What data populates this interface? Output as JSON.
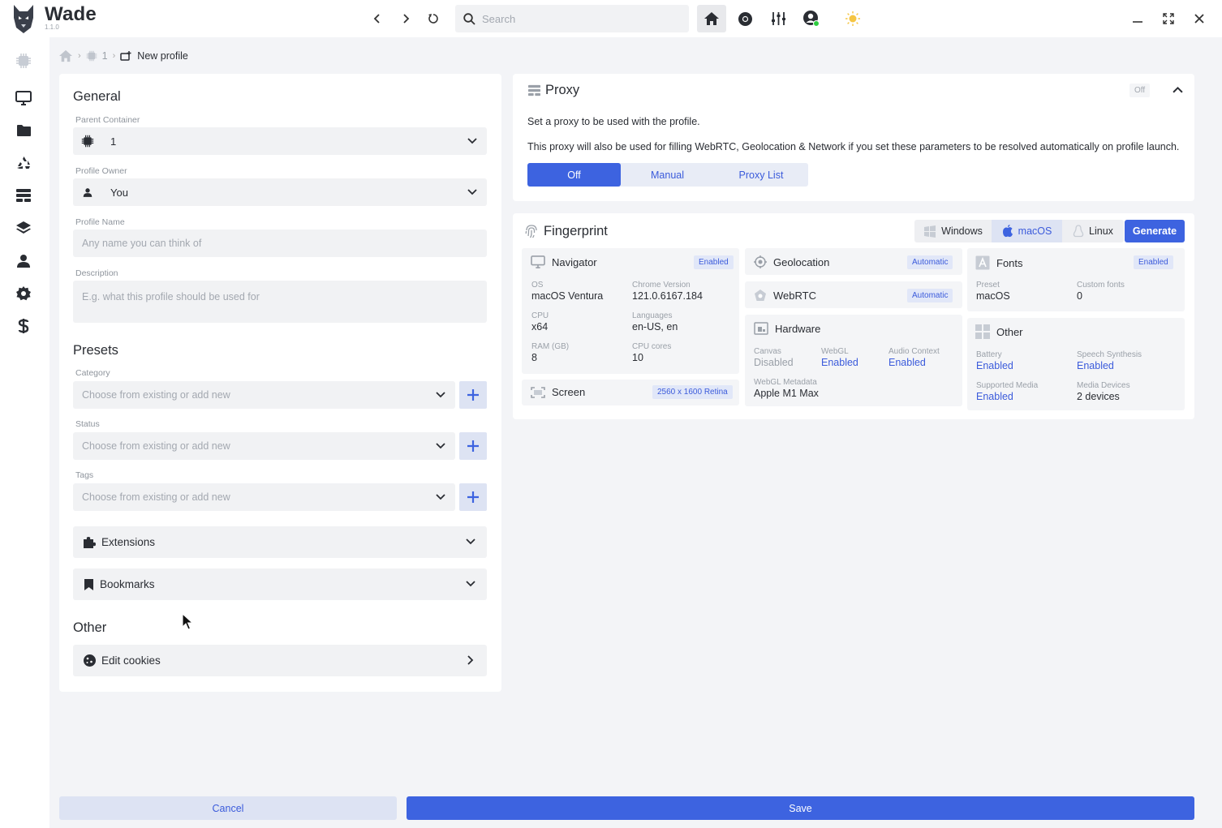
{
  "app": {
    "name": "Wade",
    "version": "1.1.0"
  },
  "titlebar": {
    "search_placeholder": "Search"
  },
  "breadcrumb": {
    "container": "1",
    "current": "New profile"
  },
  "general": {
    "title": "General",
    "parent_container": {
      "label": "Parent Container",
      "value": "1"
    },
    "profile_owner": {
      "label": "Profile Owner",
      "value": "You"
    },
    "profile_name": {
      "label": "Profile Name",
      "placeholder": "Any name you can think of"
    },
    "description": {
      "label": "Description",
      "placeholder": "E.g. what this profile should be used for"
    }
  },
  "presets": {
    "title": "Presets",
    "category": {
      "label": "Category",
      "placeholder": "Choose from existing or add new"
    },
    "status": {
      "label": "Status",
      "placeholder": "Choose from existing or add new"
    },
    "tags": {
      "label": "Tags",
      "placeholder": "Choose from existing or add new"
    },
    "extensions": "Extensions",
    "bookmarks": "Bookmarks"
  },
  "other": {
    "title": "Other",
    "edit_cookies": "Edit cookies"
  },
  "proxy": {
    "title": "Proxy",
    "status": "Off",
    "desc1": "Set a proxy to be used with the profile.",
    "desc2": "This proxy will also be used for filling WebRTC, Geolocation & Network if you set these parameters to be resolved automatically on profile launch.",
    "tabs": [
      "Off",
      "Manual",
      "Proxy List"
    ],
    "active_tab": "Off"
  },
  "fingerprint": {
    "title": "Fingerprint",
    "os_tabs": [
      "Windows",
      "macOS",
      "Linux"
    ],
    "selected_os": "macOS",
    "generate": "Generate",
    "navigator": {
      "title": "Navigator",
      "badge": "Enabled",
      "os_label": "OS",
      "os": "macOS Ventura",
      "chrome_label": "Chrome Version",
      "chrome": "121.0.6167.184",
      "cpu_label": "CPU",
      "cpu": "x64",
      "lang_label": "Languages",
      "lang": "en-US, en",
      "ram_label": "RAM (GB)",
      "ram": "8",
      "cores_label": "CPU cores",
      "cores": "10"
    },
    "screen": {
      "title": "Screen",
      "badge": "2560 x 1600 Retina"
    },
    "geolocation": {
      "title": "Geolocation",
      "badge": "Automatic"
    },
    "webrtc": {
      "title": "WebRTC",
      "badge": "Automatic"
    },
    "hardware": {
      "title": "Hardware",
      "canvas_label": "Canvas",
      "canvas": "Disabled",
      "webgl_label": "WebGL",
      "webgl": "Enabled",
      "audio_label": "Audio Context",
      "audio": "Enabled",
      "meta_label": "WebGL Metadata",
      "meta": "Apple M1 Max"
    },
    "fonts": {
      "title": "Fonts",
      "badge": "Enabled",
      "preset_label": "Preset",
      "preset": "macOS",
      "custom_label": "Custom fonts",
      "custom": "0"
    },
    "other": {
      "title": "Other",
      "battery_label": "Battery",
      "battery": "Enabled",
      "speech_label": "Speech Synthesis",
      "speech": "Enabled",
      "media_label": "Supported Media",
      "media": "Enabled",
      "devices_label": "Media Devices",
      "devices": "2 devices"
    }
  },
  "footer": {
    "cancel": "Cancel",
    "save": "Save"
  },
  "colors": {
    "accent": "#3d63e0",
    "accent_light": "#dde3f3",
    "online": "#2ecc40",
    "sun": "#f5c542"
  }
}
